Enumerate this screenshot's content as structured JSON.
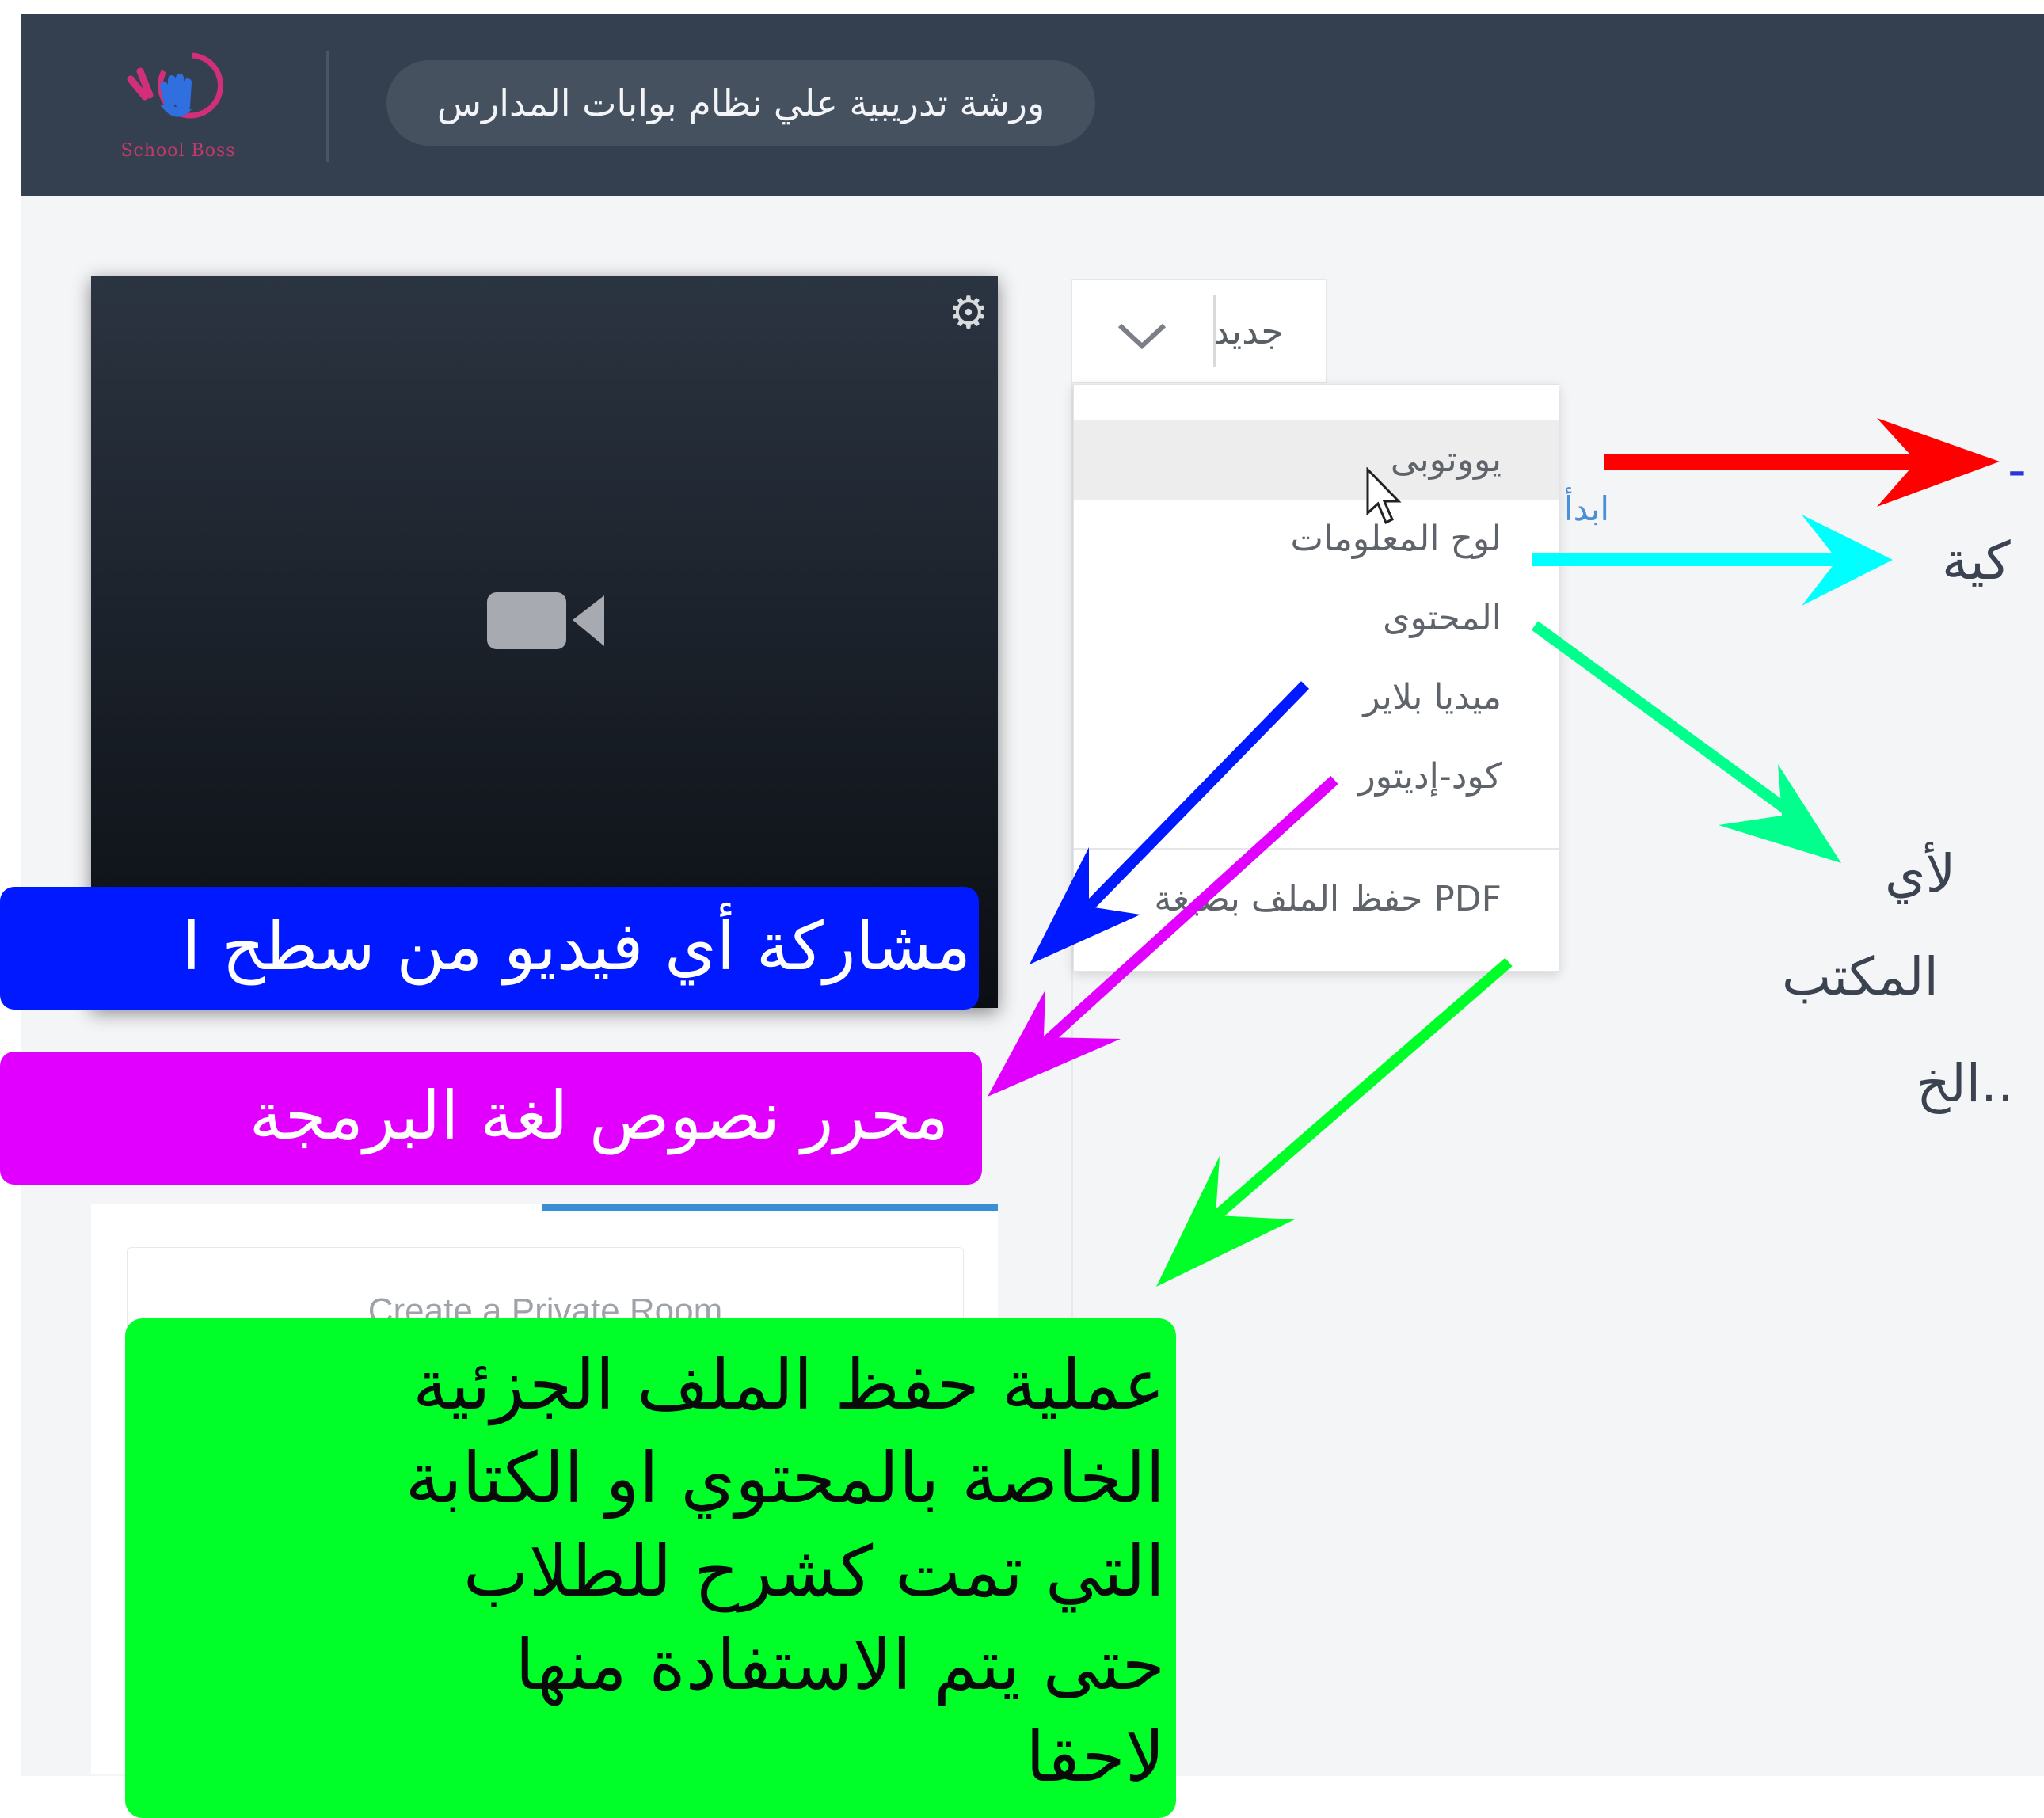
{
  "header": {
    "logo_text": "School Boss",
    "workshop_title": "ورشة تدريبية علي نظام بوابات المدارس"
  },
  "video_panel": {
    "settings_icon": "gear-icon",
    "camera_icon": "video-camera-icon"
  },
  "new_button": {
    "label": "جديد",
    "chevron_icon": "chevron-down-icon"
  },
  "dropdown_menu": {
    "items": [
      {
        "label": "يووتوبى"
      },
      {
        "label": "لوح المعلومات"
      },
      {
        "label": "المحتوى"
      },
      {
        "label": "ميديا بلاير"
      },
      {
        "label": "كود-إديتور"
      },
      {
        "label": "PDF حفظ الملف بصيغة"
      }
    ]
  },
  "side_link": "ابدأ",
  "lower_panel": {
    "card_text": "Create a Private Room"
  },
  "annotations": {
    "blue_callout": "مشاركة أي فيديو من سطح ا",
    "magenta_callout": "محرر نصوص لغة البرمجة",
    "green_callout_lines": [
      "عملية حفظ الملف الجزئية",
      "الخاصة بالمحتوي او الكتابة",
      "التي تمت كشرح للطلاب",
      "حتى يتم الاستفادة منها",
      "لاحقا"
    ],
    "right_cut_1": "كية",
    "right_cut_2": "لأي",
    "right_cut_3": "المكتب",
    "right_cut_4": "..الخ",
    "right_cut_dash": "-"
  },
  "colors": {
    "header_bg": "#34404f",
    "arrow_red": "#ff0000",
    "arrow_cyan": "#00ffff",
    "arrow_teal": "#00ff8c",
    "arrow_blue": "#0019ff",
    "arrow_magenta": "#e100ff",
    "arrow_green": "#00ff28"
  }
}
